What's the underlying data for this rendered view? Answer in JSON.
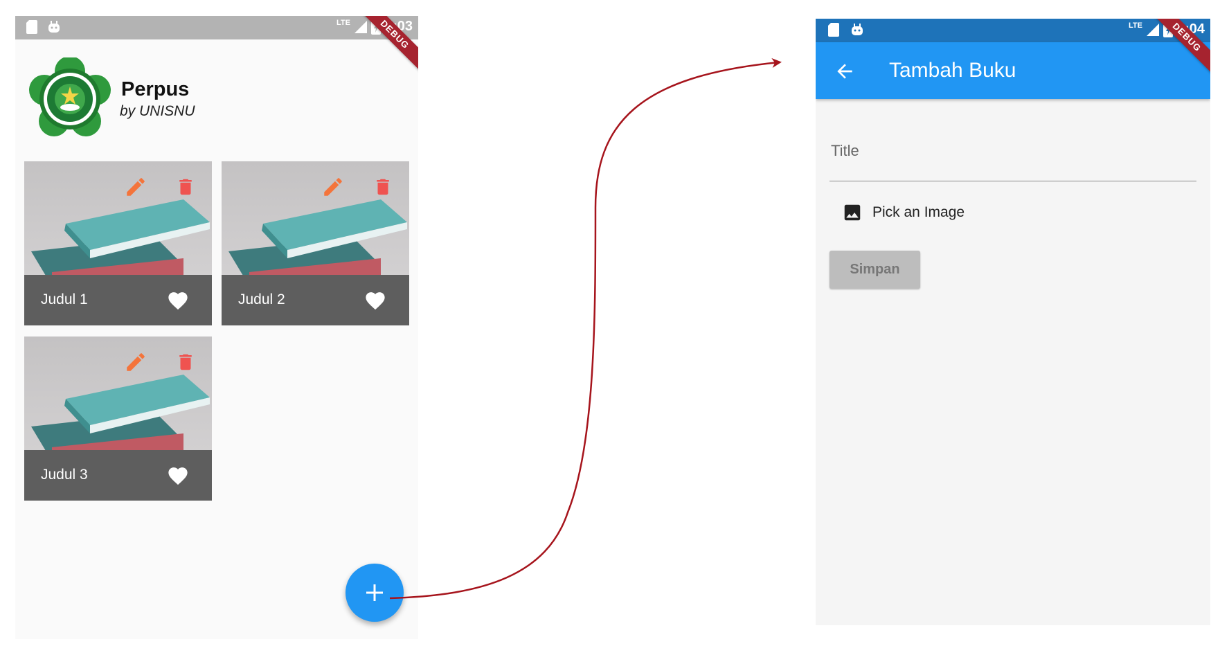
{
  "left_screen": {
    "status_time": "9:03",
    "lte": "LTE",
    "debug_label": "DEBUG",
    "app_title": "Perpus",
    "app_subtitle": "by UNISNU",
    "books": [
      {
        "title": "Judul 1"
      },
      {
        "title": "Judul 2"
      },
      {
        "title": "Judul 3"
      }
    ]
  },
  "right_screen": {
    "status_time": "9:04",
    "lte": "LTE",
    "debug_label": "DEBUG",
    "appbar_title": "Tambah Buku",
    "title_placeholder": "Title",
    "pick_image_label": "Pick an Image",
    "save_label": "Simpan"
  },
  "colors": {
    "primary": "#2196f3",
    "primary_dark": "#1e73b9",
    "edit_icon": "#f4743b",
    "delete_icon": "#ef5350",
    "card_footer": "#5e5e5e",
    "arrow": "#a6141c"
  },
  "icons": [
    "sd-card-icon",
    "android-icon",
    "signal-icon",
    "battery-icon",
    "pencil-icon",
    "trash-icon",
    "heart-icon",
    "plus-icon",
    "arrow-left-icon",
    "image-icon"
  ]
}
